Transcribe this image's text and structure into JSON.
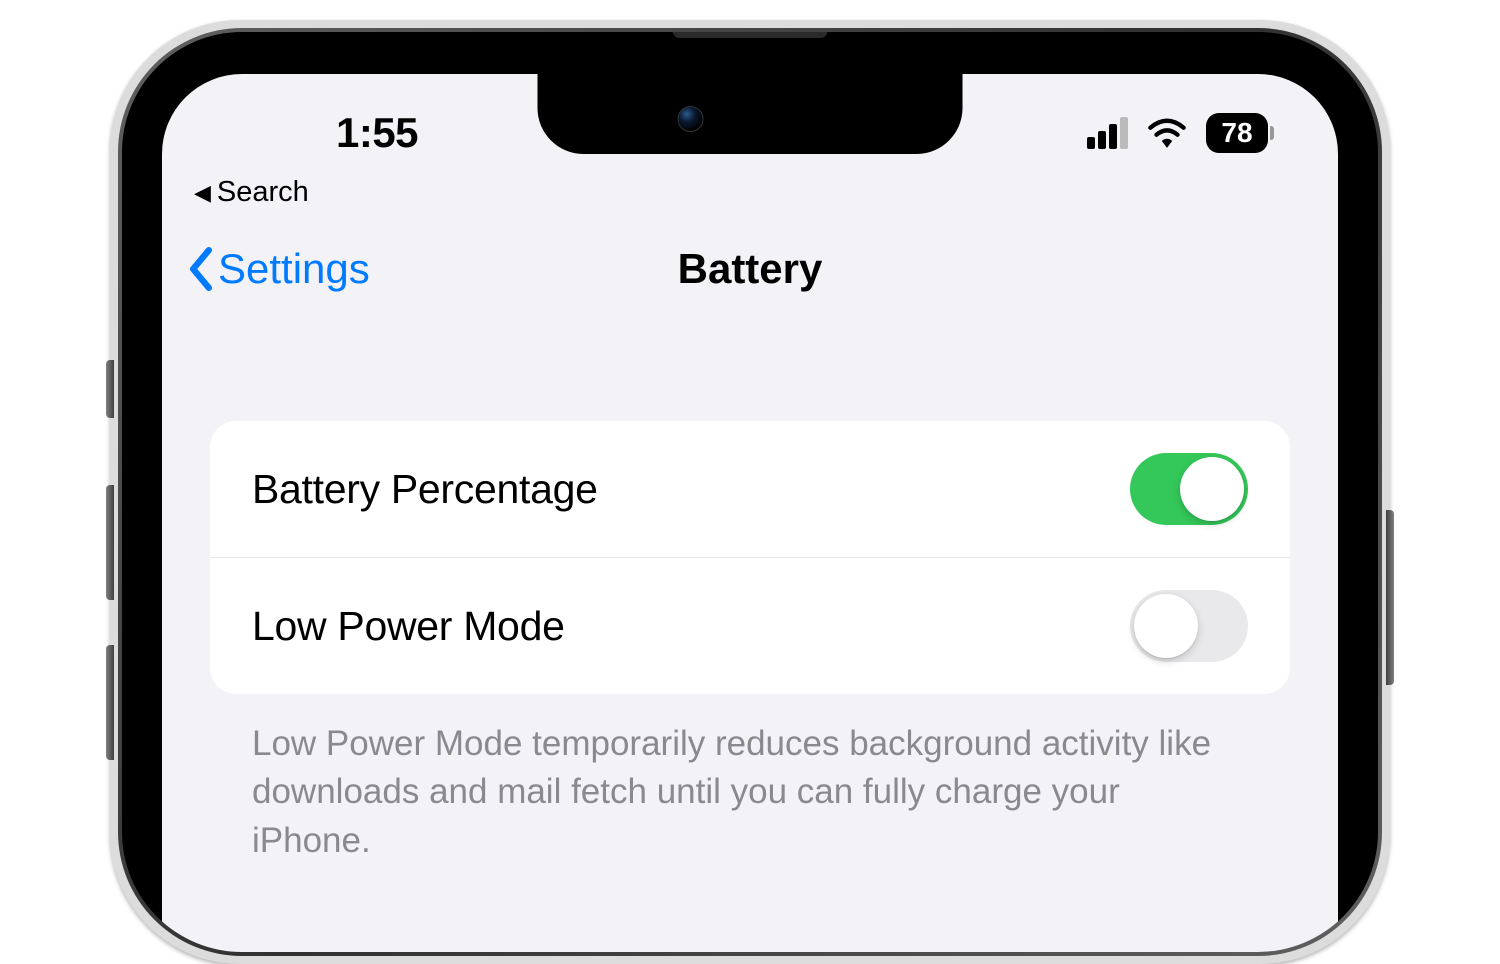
{
  "status_bar": {
    "time": "1:55",
    "battery_percentage": "78",
    "cellular_strength": 3,
    "wifi_connected": true
  },
  "breadcrumb": {
    "back_label": "Search"
  },
  "nav": {
    "back_label": "Settings",
    "title": "Battery"
  },
  "settings": {
    "items": [
      {
        "label": "Battery Percentage",
        "enabled": true
      },
      {
        "label": "Low Power Mode",
        "enabled": false
      }
    ],
    "footer": "Low Power Mode temporarily reduces background activity like downloads and mail fetch until you can fully charge your iPhone."
  },
  "colors": {
    "accent": "#007aff",
    "toggle_on": "#34c759",
    "toggle_off": "#e9e9eb",
    "background": "#f2f2f7"
  }
}
